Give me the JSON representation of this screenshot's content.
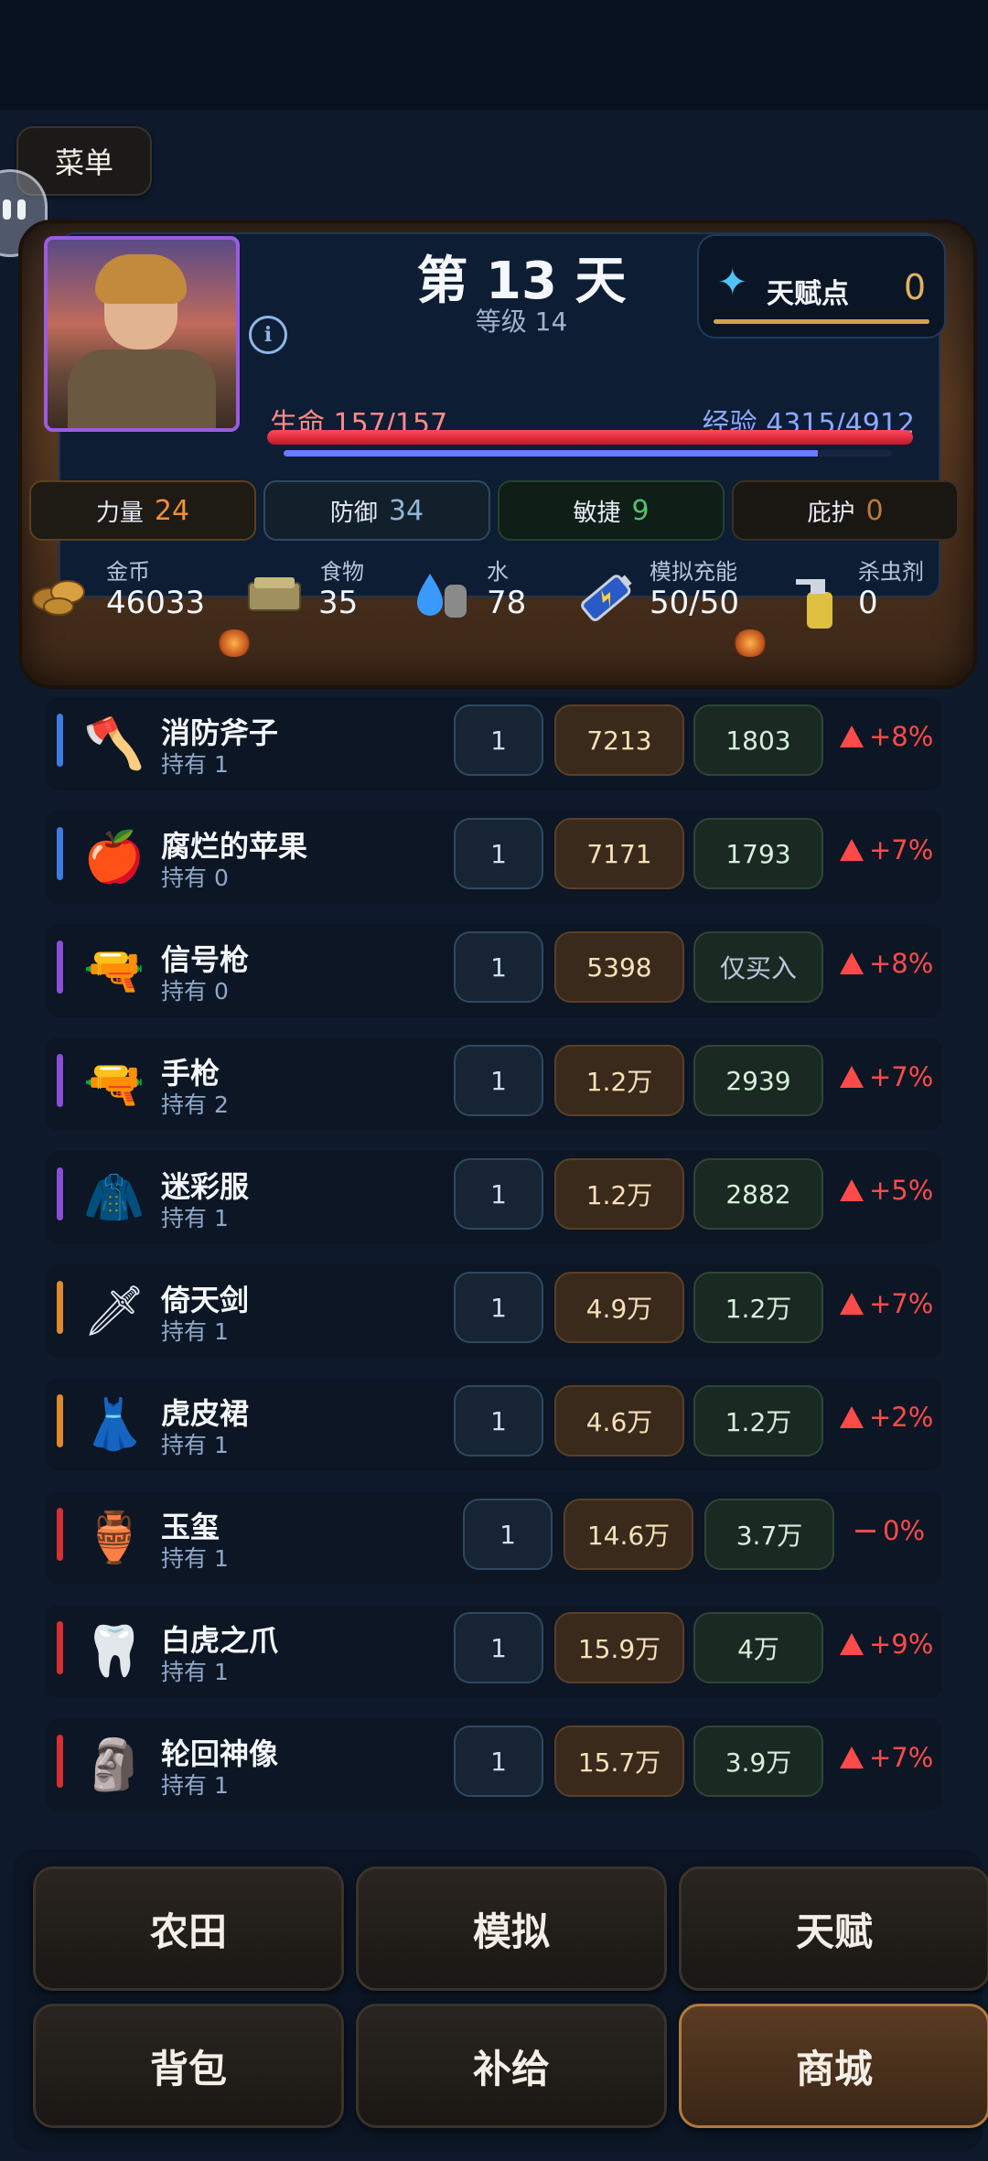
{
  "menu_label": "菜单",
  "header": {
    "day_title": "第 13 天",
    "level": "等级 14",
    "talent_label": "天赋点",
    "talent_value": "0",
    "hp_label": "生命 157/157",
    "hp_fraction": 1.0,
    "exp_label": "经验 4315/4912",
    "exp_fraction": 0.878
  },
  "stats": [
    {
      "label": "力量",
      "value": "24"
    },
    {
      "label": "防御",
      "value": "34"
    },
    {
      "label": "敏捷",
      "value": "9"
    },
    {
      "label": "庇护",
      "value": "0"
    }
  ],
  "resources": [
    {
      "label": "金币",
      "value": "46033",
      "icon": "coins-icon"
    },
    {
      "label": "食物",
      "value": "35",
      "icon": "food-icon"
    },
    {
      "label": "水",
      "value": "78",
      "icon": "water-icon"
    },
    {
      "label": "模拟充能",
      "value": "50/50",
      "icon": "battery-icon"
    },
    {
      "label": "杀虫剂",
      "value": "0",
      "icon": "spray-icon"
    }
  ],
  "items": [
    {
      "name": "消防斧子",
      "owned": "持有 1",
      "qty": "1",
      "buy": "7213",
      "sell": "1803",
      "trend": "+8%",
      "rarity_color": "#3b7de0",
      "icon": "🪓",
      "dir": "up"
    },
    {
      "name": "腐烂的苹果",
      "owned": "持有 0",
      "qty": "1",
      "buy": "7171",
      "sell": "1793",
      "trend": "+7%",
      "rarity_color": "#3b7de0",
      "icon": "🍎",
      "dir": "up"
    },
    {
      "name": "信号枪",
      "owned": "持有 0",
      "qty": "1",
      "buy": "5398",
      "sell": "仅买入",
      "trend": "+8%",
      "rarity_color": "#8a4ed8",
      "icon": "🔫",
      "dir": "up"
    },
    {
      "name": "手枪",
      "owned": "持有 2",
      "qty": "1",
      "buy": "1.2万",
      "sell": "2939",
      "trend": "+7%",
      "rarity_color": "#8a4ed8",
      "icon": "🔫",
      "dir": "up"
    },
    {
      "name": "迷彩服",
      "owned": "持有 1",
      "qty": "1",
      "buy": "1.2万",
      "sell": "2882",
      "trend": "+5%",
      "rarity_color": "#8a4ed8",
      "icon": "🧥",
      "dir": "up"
    },
    {
      "name": "倚天剑",
      "owned": "持有 1",
      "qty": "1",
      "buy": "4.9万",
      "sell": "1.2万",
      "trend": "+7%",
      "rarity_color": "#e08a2a",
      "icon": "🗡",
      "dir": "up"
    },
    {
      "name": "虎皮裙",
      "owned": "持有 1",
      "qty": "1",
      "buy": "4.6万",
      "sell": "1.2万",
      "trend": "+2%",
      "rarity_color": "#e08a2a",
      "icon": "👗",
      "dir": "up"
    },
    {
      "name": "玉玺",
      "owned": "持有 1",
      "qty": "1",
      "buy": "14.6万",
      "sell": "3.7万",
      "trend": "0%",
      "rarity_color": "#d83030",
      "icon": "🏺",
      "dir": "flat"
    },
    {
      "name": "白虎之爪",
      "owned": "持有 1",
      "qty": "1",
      "buy": "15.9万",
      "sell": "4万",
      "trend": "+9%",
      "rarity_color": "#d83030",
      "icon": "🦷",
      "dir": "up"
    },
    {
      "name": "轮回神像",
      "owned": "持有 1",
      "qty": "1",
      "buy": "15.7万",
      "sell": "3.9万",
      "trend": "+7%",
      "rarity_color": "#d83030",
      "icon": "🗿",
      "dir": "up"
    }
  ],
  "nav": [
    {
      "label": "农田"
    },
    {
      "label": "模拟"
    },
    {
      "label": "天赋"
    },
    {
      "label": "背包"
    },
    {
      "label": "补给"
    },
    {
      "label": "商城",
      "active": true
    }
  ]
}
